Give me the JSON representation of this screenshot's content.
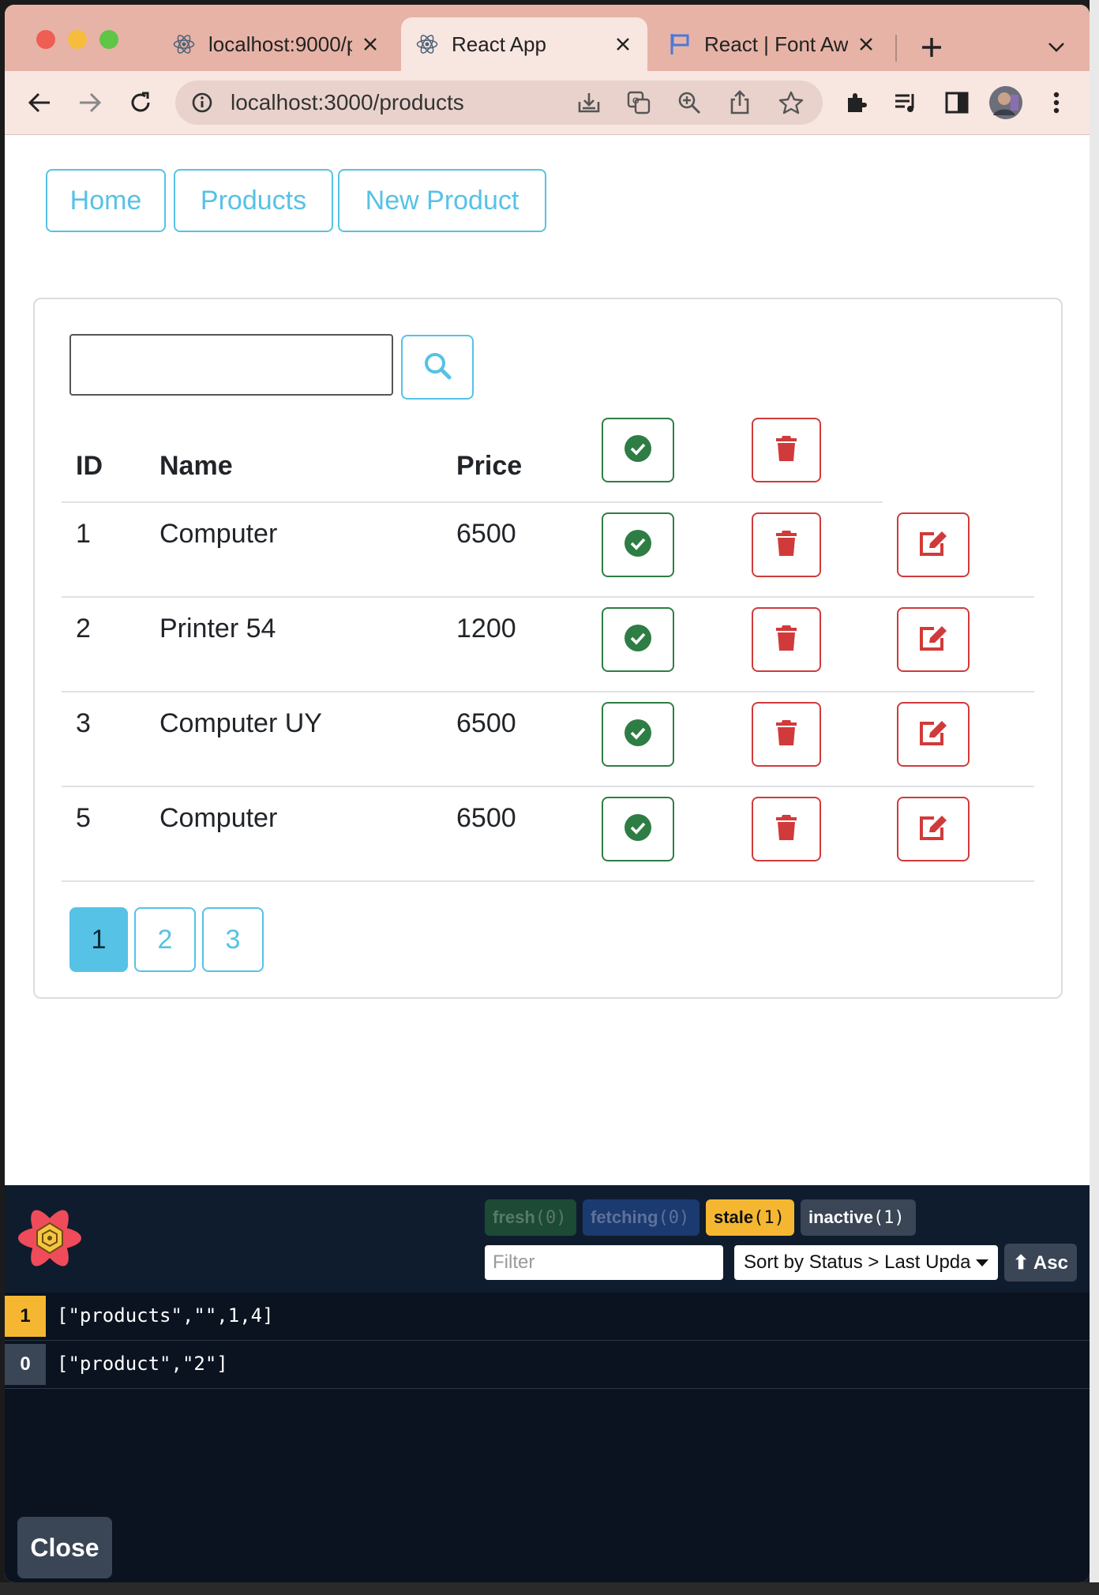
{
  "browser": {
    "tabs": [
      {
        "title": "localhost:9000/p",
        "active": false,
        "icon": "react-icon"
      },
      {
        "title": "React App",
        "active": true,
        "icon": "react-icon"
      },
      {
        "title": "React | Font Awe",
        "active": false,
        "icon": "flag-icon"
      }
    ],
    "url": "localhost:3000/products"
  },
  "nav": {
    "home": "Home",
    "products": "Products",
    "new_product": "New Product"
  },
  "search": {
    "placeholder": "",
    "value": ""
  },
  "table": {
    "headers": {
      "id": "ID",
      "name": "Name",
      "price": "Price"
    },
    "rows": [
      {
        "id": "1",
        "name": "Computer",
        "price": "6500",
        "checked": true
      },
      {
        "id": "2",
        "name": "Printer 54",
        "price": "1200",
        "checked": true
      },
      {
        "id": "3",
        "name": "Computer UY",
        "price": "6500",
        "checked": true
      },
      {
        "id": "5",
        "name": "Computer",
        "price": "6500",
        "checked": true
      }
    ]
  },
  "pagination": {
    "pages": [
      "1",
      "2",
      "3"
    ],
    "current": "1"
  },
  "devtools": {
    "badges": {
      "fresh": {
        "label": "fresh",
        "count": "(0)"
      },
      "fetching": {
        "label": "fetching",
        "count": "(0)"
      },
      "stale": {
        "label": "stale",
        "count": "(1)"
      },
      "inactive": {
        "label": "inactive",
        "count": "(1)"
      }
    },
    "filter_placeholder": "Filter",
    "sort_label": "Sort by Status > Last Upda",
    "asc_label": "⬆ Asc",
    "queries": [
      {
        "count": "1",
        "key": "[\"products\",\"\",1,4]",
        "status": "stale"
      },
      {
        "count": "0",
        "key": "[\"product\",\"2\"]",
        "status": "inactive"
      }
    ],
    "close_label": "Close"
  },
  "colors": {
    "info": "#56c2e6",
    "success": "#2e7d44",
    "danger": "#d13a3a",
    "stale": "#f5b731"
  }
}
